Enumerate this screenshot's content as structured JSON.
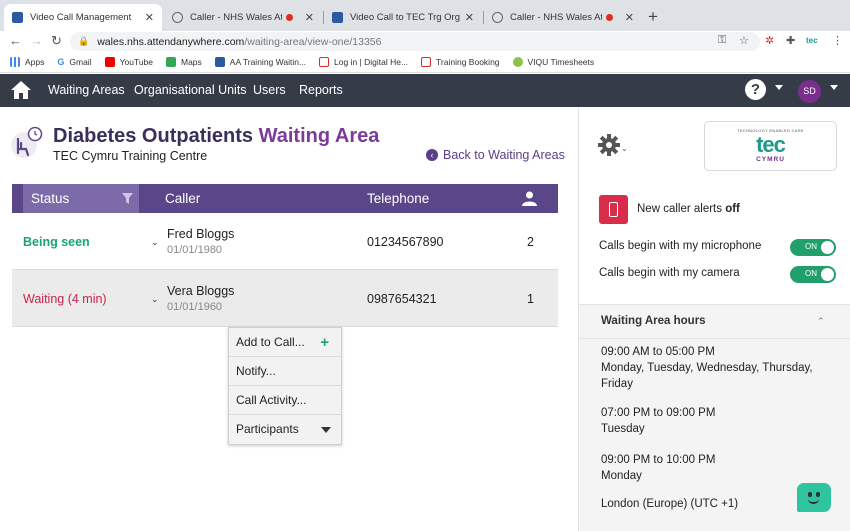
{
  "browser": {
    "tabs": [
      {
        "title": "Video Call Management",
        "recording": false
      },
      {
        "title": "Caller - NHS Wales Attend Anywhere",
        "recording": true
      },
      {
        "title": "Video Call to TEC Trg Org",
        "recording": false
      },
      {
        "title": "Caller - NHS Wales Attend Anywhere",
        "recording": true
      }
    ],
    "url_host": "wales.nhs.attendanywhere.com",
    "url_path": "/waiting-area/view-one/13356",
    "bookmarks": [
      "Apps",
      "Gmail",
      "YouTube",
      "Maps",
      "AA Training Waitin...",
      "Log in | Digital He...",
      "Training Booking",
      "VIQU Timesheets"
    ]
  },
  "nav": {
    "items": [
      "Waiting Areas",
      "Organisational Units",
      "Users",
      "Reports"
    ],
    "help": "?",
    "avatar": "SD"
  },
  "header": {
    "title_main": "Diabetes Outpatients",
    "title_accent": "Waiting Area",
    "org": "TEC Cymru Training Centre",
    "back_link": "Back to Waiting Areas"
  },
  "table": {
    "columns": {
      "status": "Status",
      "caller": "Caller",
      "telephone": "Telephone"
    },
    "rows": [
      {
        "status": "Being seen",
        "name": "Fred Bloggs",
        "dob": "01/01/1980",
        "phone": "01234567890",
        "count": "2"
      },
      {
        "status": "Waiting (4 min)",
        "name": "Vera Bloggs",
        "dob": "01/01/1960",
        "phone": "0987654321",
        "count": "1"
      }
    ]
  },
  "dropdown": {
    "items": [
      "Add to Call...",
      "Notify...",
      "Call Activity...",
      "Participants"
    ]
  },
  "side": {
    "logo_small": "TECHNOLOGY ENABLED CARE",
    "logo_main": "tec",
    "logo_sub": "CYMRU",
    "alerts_label": "New caller alerts",
    "alerts_value": "off",
    "toggles": [
      {
        "label": "Calls begin with my microphone",
        "state": "ON"
      },
      {
        "label": "Calls begin with my camera",
        "state": "ON"
      }
    ],
    "hours_title": "Waiting Area hours",
    "hours": [
      {
        "time": "09:00 AM to 05:00 PM",
        "days": "Monday, Tuesday, Wednesday, Thursday, Friday"
      },
      {
        "time": "07:00 PM to 09:00 PM",
        "days": "Tuesday"
      },
      {
        "time": "09:00 PM to 10:00 PM",
        "days": "Monday"
      }
    ],
    "timezone": "London (Europe) (UTC +1)"
  },
  "colors": {
    "being_seen": "#1aa37a",
    "waiting": "#c8244b",
    "header_bg": "#5a4689",
    "accent": "#7d3a9a"
  }
}
